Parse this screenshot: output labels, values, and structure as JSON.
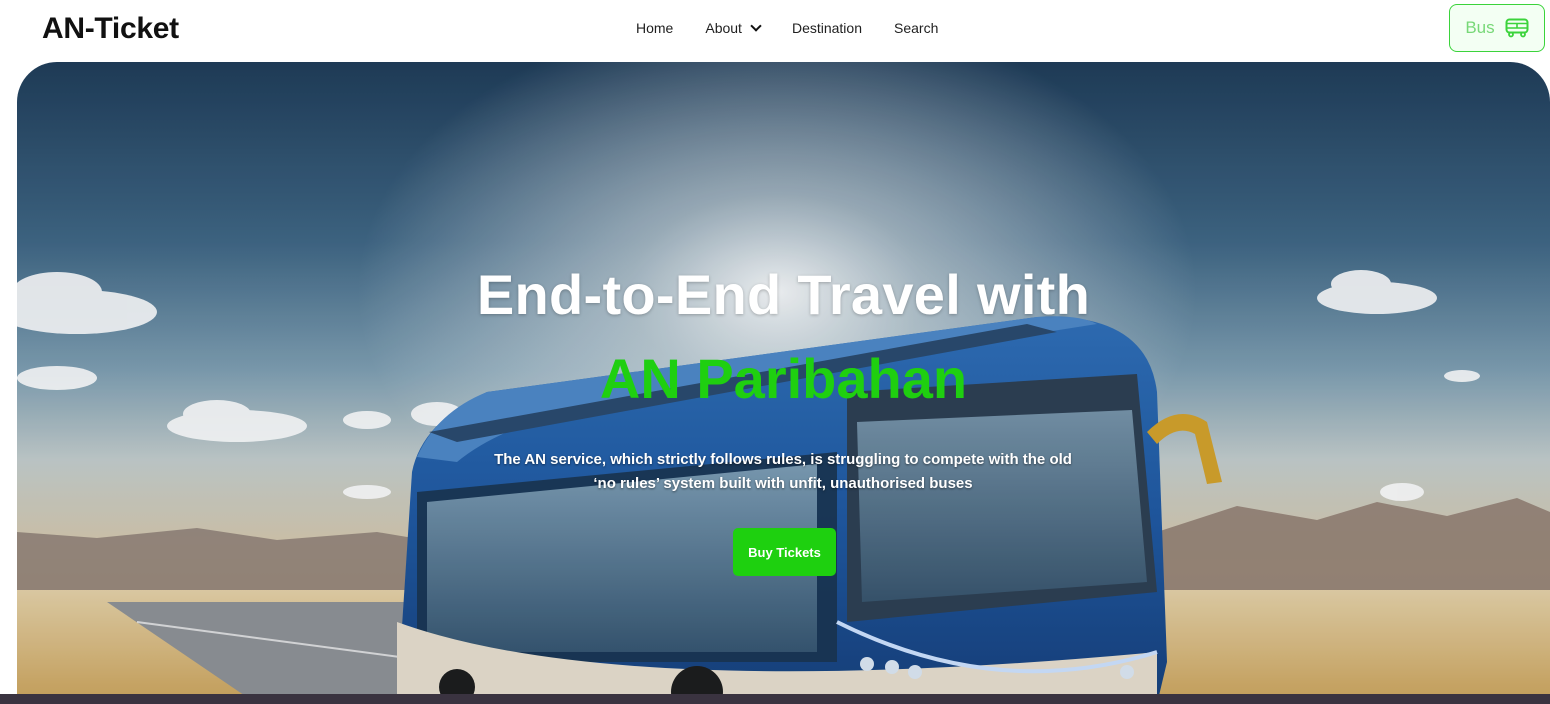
{
  "brand": {
    "name": "AN-Ticket"
  },
  "nav": {
    "items": [
      {
        "label": "Home"
      },
      {
        "label": "About",
        "has_dropdown": true
      },
      {
        "label": "Destination"
      },
      {
        "label": "Search"
      }
    ]
  },
  "header_button": {
    "label": "Bus",
    "icon": "bus-icon"
  },
  "hero": {
    "title_line1": "End-to-End Travel with",
    "title_line2": "AN Paribahan",
    "subtitle": "The AN service, which strictly follows rules, is struggling to compete with the old ‘no rules’ system built with unfit, unauthorised buses",
    "cta_label": "Buy Tickets"
  },
  "colors": {
    "accent": "#1ed00f",
    "bus_button_border": "#3bd33b",
    "bus_button_text": "#77d877",
    "brand_text": "#111111"
  }
}
